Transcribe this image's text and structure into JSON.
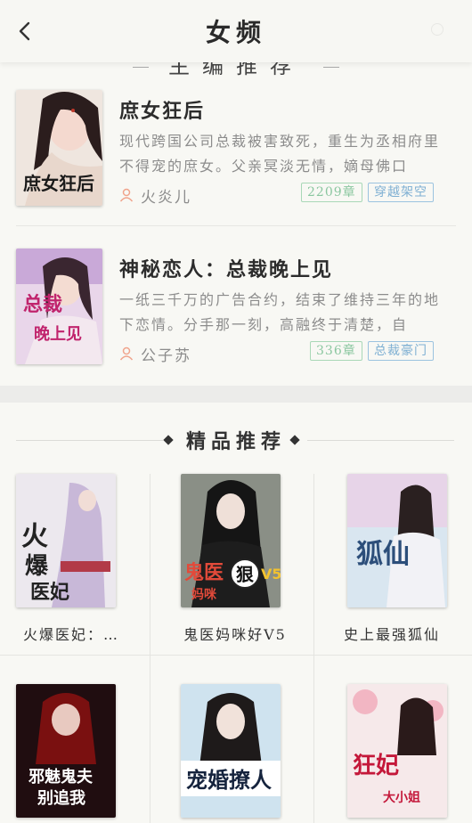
{
  "header": {
    "title": "女频"
  },
  "top_section": {
    "partial_heading": "主编推荐",
    "books": [
      {
        "name": "庶女狂后",
        "description": "现代跨国公司总裁被害致死，重生为丞相府里不得宠的庶女。父亲冥淡无情，嫡母佛口",
        "author": "火炎儿",
        "chapters": "2209章",
        "genre": "穿越架空",
        "cover_text": "庶女狂后"
      },
      {
        "name": "神秘恋人：总裁晚上见",
        "description": "一纸三千万的广告合约，结束了维持三年的地下恋情。分手那一刻，高融终于清楚，自",
        "author": "公子苏",
        "chapters": "336章",
        "genre": "总裁豪门",
        "cover_text": "总裁晚上见"
      }
    ]
  },
  "recommend_section": {
    "title": "精品推荐",
    "books": [
      {
        "name": "火爆医妃：…",
        "cover_text": "火爆医妃"
      },
      {
        "name": "鬼医妈咪好V5",
        "cover_text": "鬼医妈咪"
      },
      {
        "name": "史上最强狐仙",
        "cover_text": "狐仙"
      },
      {
        "name": "",
        "cover_text": "邪魅鬼夫别追我"
      },
      {
        "name": "",
        "cover_text": "宠婚撩人"
      },
      {
        "name": "",
        "cover_text": "狂妃"
      }
    ]
  },
  "colors": {
    "tag_green": "#8bc7a0",
    "tag_blue": "#7fb0d3",
    "background": "#f6f6f2"
  }
}
